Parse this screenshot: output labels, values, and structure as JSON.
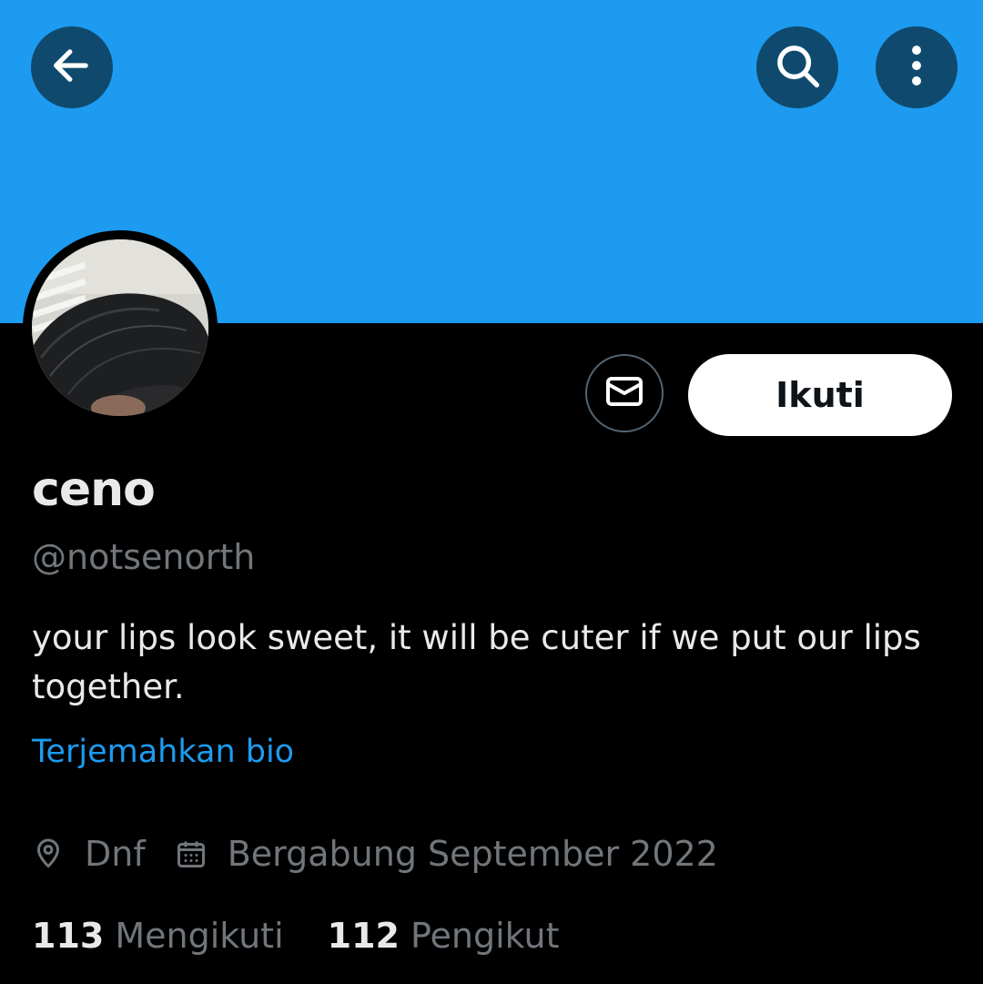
{
  "header": {
    "banner_color": "#1d9bf0",
    "back_icon": "arrow-left-icon",
    "search_icon": "search-icon",
    "more_icon": "more-vertical-icon"
  },
  "profile": {
    "display_name": "ceno",
    "handle": "@notsenorth",
    "bio": "your lips look sweet, it will be cuter if we put our lips together.",
    "translate_label": "Terjemahkan bio",
    "location": "Dnf",
    "joined": "Bergabung September 2022"
  },
  "actions": {
    "message_icon": "mail-icon",
    "follow_label": "Ikuti"
  },
  "stats": {
    "following_count": "113",
    "following_label": "Mengikuti",
    "followers_count": "112",
    "followers_label": "Pengikut"
  },
  "colors": {
    "accent": "#1d9bf0",
    "background": "#000000",
    "muted_text": "#71767b",
    "primary_text": "#e7e9ea"
  }
}
